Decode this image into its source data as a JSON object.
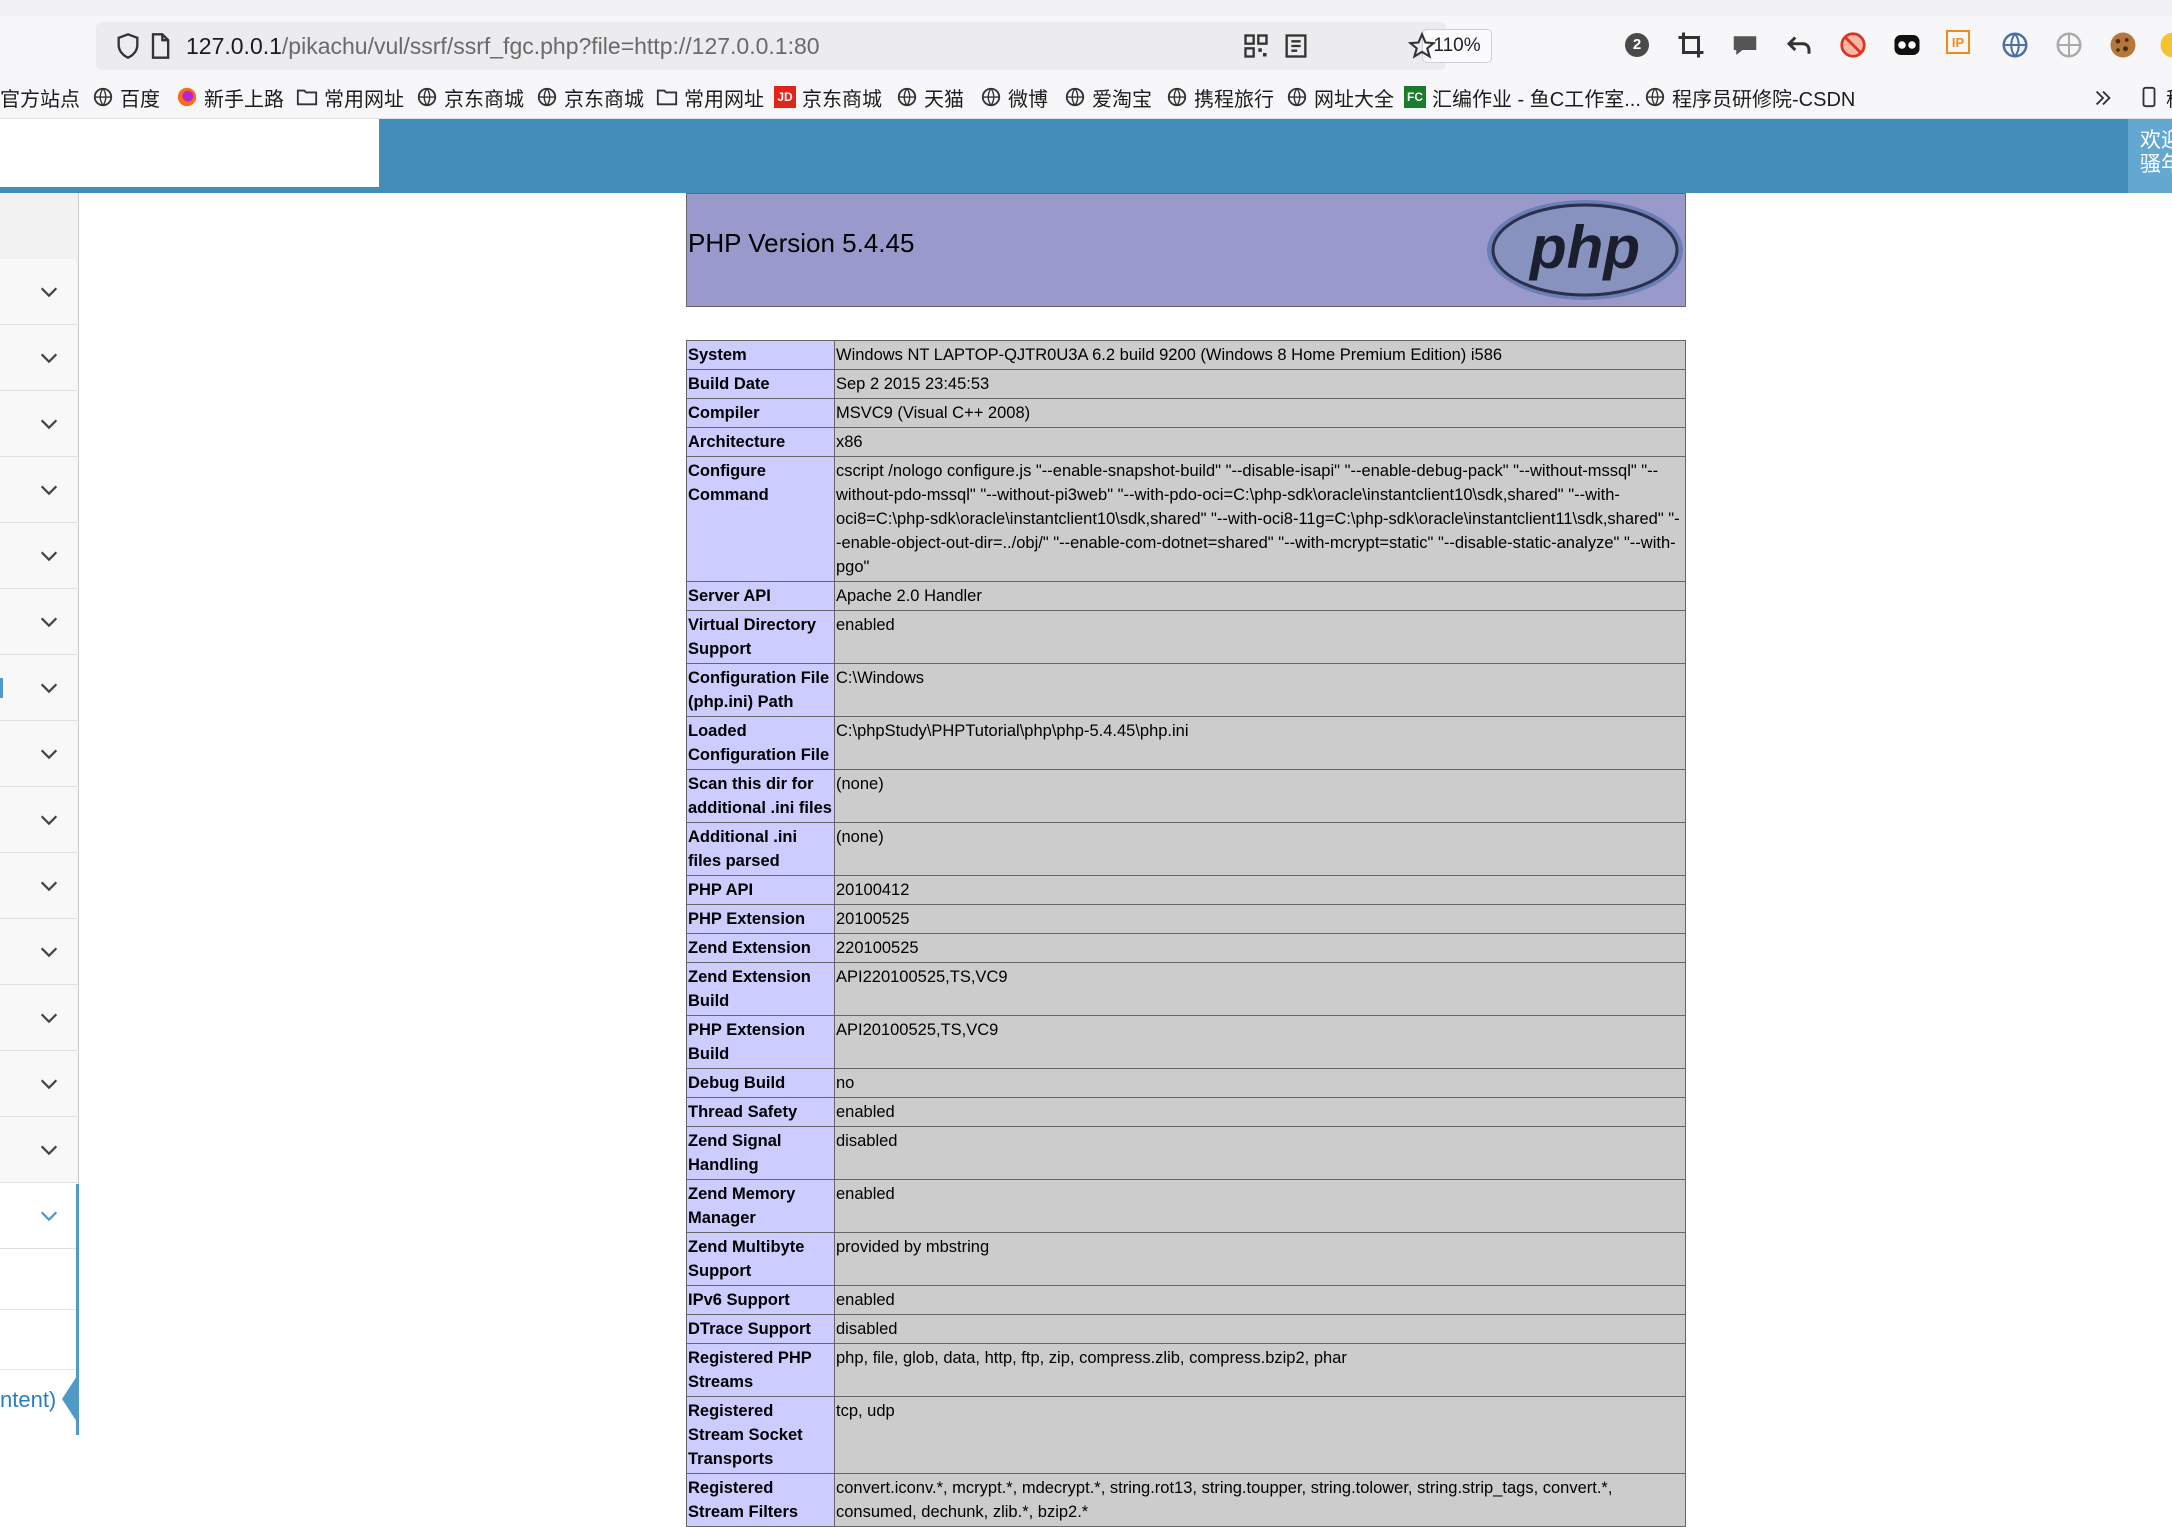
{
  "browser": {
    "url_host": "127.0.0.1",
    "url_path": "/pikachu/vul/ssrf/ssrf_fgc.php?file=http://127.0.0.1:80",
    "zoom": "110%",
    "extensions": [
      "badge-2-icon",
      "crop-icon",
      "chat-icon",
      "undo-icon",
      "no-tracking-icon",
      "ghost-icon",
      "ip-icon",
      "globe-grid-icon",
      "gray-globe-icon",
      "cookie-icon",
      "color-wheel-icon"
    ],
    "extension_badge_count": "2",
    "extension_ip_label": "IP",
    "bookmarks": [
      {
        "label": "官方站点",
        "icon": "none"
      },
      {
        "label": "百度",
        "icon": "globe-icon"
      },
      {
        "label": "新手上路",
        "icon": "firefox-icon"
      },
      {
        "label": "常用网址",
        "icon": "folder-icon"
      },
      {
        "label": "京东商城",
        "icon": "globe-icon"
      },
      {
        "label": "京东商城",
        "icon": "globe-icon"
      },
      {
        "label": "常用网址",
        "icon": "folder-icon"
      },
      {
        "label": "京东商城",
        "icon": "jd-icon"
      },
      {
        "label": "天猫",
        "icon": "globe-icon"
      },
      {
        "label": "微博",
        "icon": "globe-icon"
      },
      {
        "label": "爱淘宝",
        "icon": "globe-icon"
      },
      {
        "label": "携程旅行",
        "icon": "globe-icon"
      },
      {
        "label": "网址大全",
        "icon": "globe-icon"
      },
      {
        "label": "汇编作业 - 鱼C工作室...",
        "icon": "fc-icon"
      },
      {
        "label": "程序员研修院-CSDN",
        "icon": "globe-icon"
      }
    ],
    "jd_icon_text": "JD",
    "fc_icon_text": "FC",
    "overflow_label": "移"
  },
  "site": {
    "welcome_line1": "欢迎",
    "welcome_line2": "骚年",
    "sidebar_active_text": "ntent)"
  },
  "phpinfo": {
    "version_title": "PHP Version 5.4.45",
    "logo_text": "php",
    "rows": [
      {
        "k": "System",
        "v": "Windows NT LAPTOP-QJTR0U3A 6.2 build 9200 (Windows 8 Home Premium Edition) i586"
      },
      {
        "k": "Build Date",
        "v": "Sep 2 2015 23:45:53"
      },
      {
        "k": "Compiler",
        "v": "MSVC9 (Visual C++ 2008)"
      },
      {
        "k": "Architecture",
        "v": "x86"
      },
      {
        "k": "Configure Command",
        "v": "cscript /nologo configure.js \"--enable-snapshot-build\" \"--disable-isapi\" \"--enable-debug-pack\" \"--without-mssql\" \"--without-pdo-mssql\" \"--without-pi3web\" \"--with-pdo-oci=C:\\php-sdk\\oracle\\instantclient10\\sdk,shared\" \"--with-oci8=C:\\php-sdk\\oracle\\instantclient10\\sdk,shared\" \"--with-oci8-11g=C:\\php-sdk\\oracle\\instantclient11\\sdk,shared\" \"--enable-object-out-dir=../obj/\" \"--enable-com-dotnet=shared\" \"--with-mcrypt=static\" \"--disable-static-analyze\" \"--with-pgo\""
      },
      {
        "k": "Server API",
        "v": "Apache 2.0 Handler"
      },
      {
        "k": "Virtual Directory Support",
        "v": "enabled"
      },
      {
        "k": "Configuration File (php.ini) Path",
        "v": "C:\\Windows"
      },
      {
        "k": "Loaded Configuration File",
        "v": "C:\\phpStudy\\PHPTutorial\\php\\php-5.4.45\\php.ini"
      },
      {
        "k": "Scan this dir for additional .ini files",
        "v": "(none)"
      },
      {
        "k": "Additional .ini files parsed",
        "v": "(none)"
      },
      {
        "k": "PHP API",
        "v": "20100412"
      },
      {
        "k": "PHP Extension",
        "v": "20100525"
      },
      {
        "k": "Zend Extension",
        "v": "220100525"
      },
      {
        "k": "Zend Extension Build",
        "v": "API220100525,TS,VC9"
      },
      {
        "k": "PHP Extension Build",
        "v": "API20100525,TS,VC9"
      },
      {
        "k": "Debug Build",
        "v": "no"
      },
      {
        "k": "Thread Safety",
        "v": "enabled"
      },
      {
        "k": "Zend Signal Handling",
        "v": "disabled"
      },
      {
        "k": "Zend Memory Manager",
        "v": "enabled"
      },
      {
        "k": "Zend Multibyte Support",
        "v": "provided by mbstring"
      },
      {
        "k": "IPv6 Support",
        "v": "enabled"
      },
      {
        "k": "DTrace Support",
        "v": "disabled"
      },
      {
        "k": "Registered PHP Streams",
        "v": "php, file, glob, data, http, ftp, zip, compress.zlib, compress.bzip2, phar"
      },
      {
        "k": "Registered Stream Socket Transports",
        "v": "tcp, udp"
      },
      {
        "k": "Registered Stream Filters",
        "v": "convert.iconv.*, mcrypt.*, mdecrypt.*, string.rot13, string.toupper, string.tolower, string.strip_tags, convert.*, consumed, dechunk, zlib.*, bzip2.*"
      }
    ]
  },
  "colors": {
    "header_blue": "#438eb9",
    "php_header": "#9999cc",
    "php_key_cell": "#ccccff",
    "php_value_cell": "#cccccc"
  }
}
